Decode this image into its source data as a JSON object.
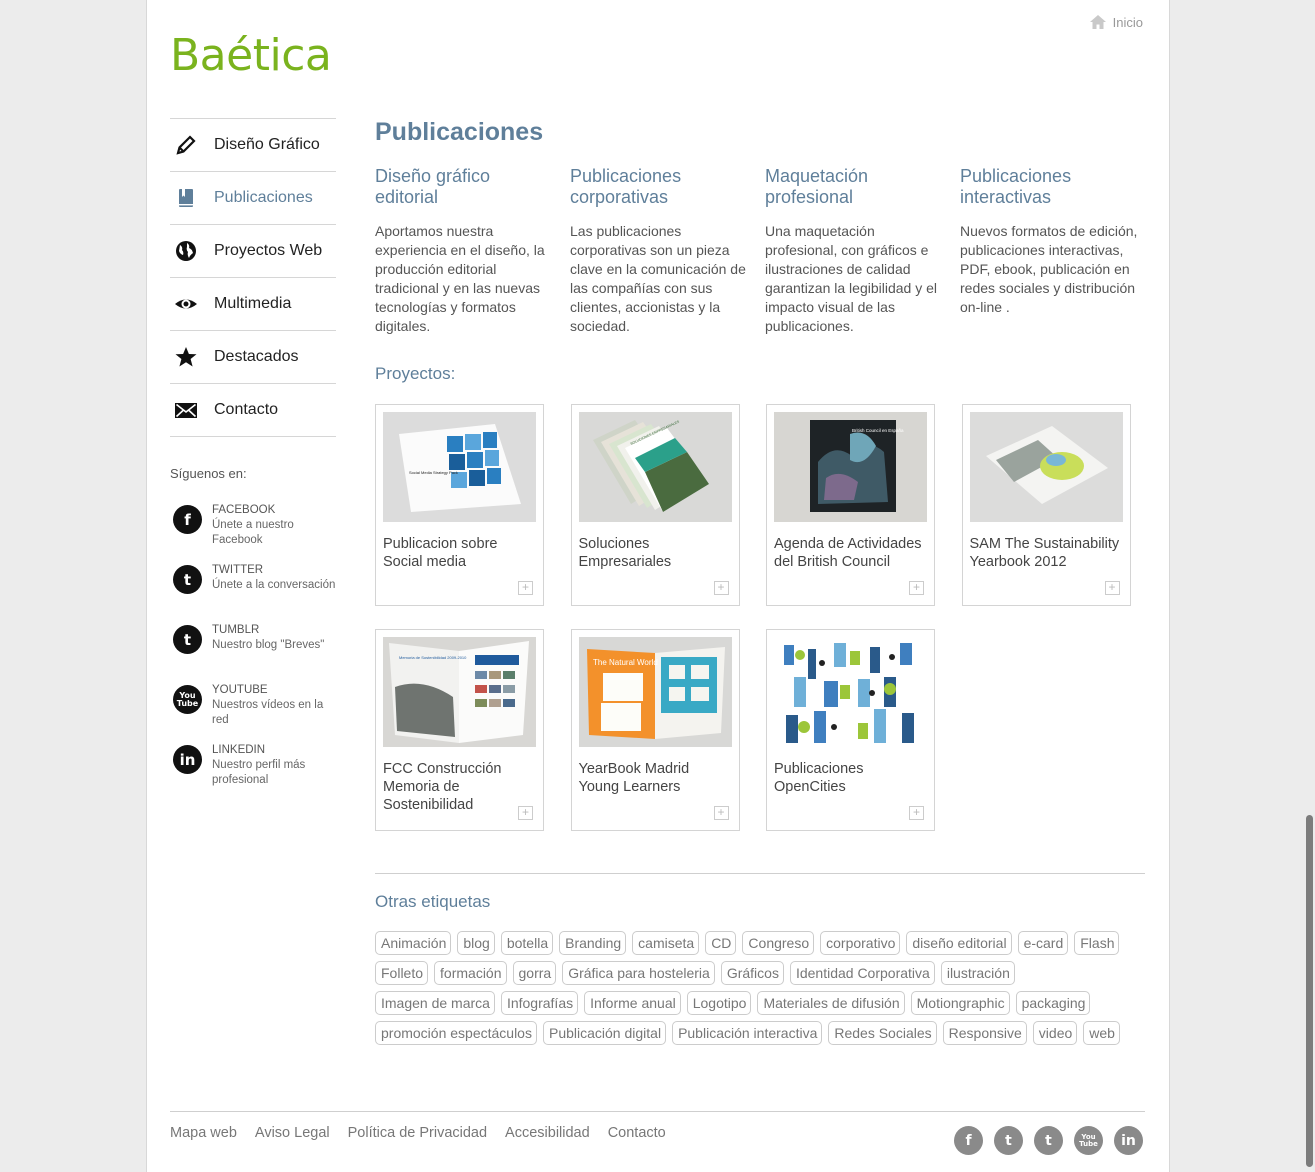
{
  "header": {
    "logo": "Baética",
    "home_label": "Inicio"
  },
  "nav": {
    "items": [
      {
        "label": "Diseño Gráfico",
        "icon": "pencil-icon"
      },
      {
        "label": "Publicaciones",
        "icon": "book-icon"
      },
      {
        "label": "Proyectos Web",
        "icon": "globe-icon"
      },
      {
        "label": "Multimedia",
        "icon": "eye-icon"
      },
      {
        "label": "Destacados",
        "icon": "star-icon"
      },
      {
        "label": "Contacto",
        "icon": "envelope-icon"
      }
    ],
    "active_index": 1
  },
  "social": {
    "title": "Síguenos en:",
    "items": [
      {
        "name": "FACEBOOK",
        "desc": "Únete a nuestro Facebook",
        "icon": "facebook-icon"
      },
      {
        "name": "TWITTER",
        "desc": "Únete a la conversación",
        "icon": "twitter-icon"
      },
      {
        "name": "TUMBLR",
        "desc": "Nuestro blog \"Breves\"",
        "icon": "tumblr-icon"
      },
      {
        "name": "YOUTUBE",
        "desc": "Nuestros vídeos en la red",
        "icon": "youtube-icon"
      },
      {
        "name": "LINKEDIN",
        "desc": "Nuestro perfil más profesional",
        "icon": "linkedin-icon"
      }
    ]
  },
  "main": {
    "title": "Publicaciones",
    "services": [
      {
        "title": "Diseño gráfico editorial",
        "desc": "Aportamos nuestra experiencia en el diseño, la producción editorial tradicional y en las nuevas tecnologías y formatos digitales."
      },
      {
        "title": "Publicaciones corporativas",
        "desc": "Las publicaciones corporativas son un pieza clave en la comunicación de las compañías con sus clientes, accionistas y la sociedad."
      },
      {
        "title": "Maquetación profesional",
        "desc": "Una maquetación profesional, con gráficos e ilustraciones de calidad garantizan la legibilidad y el impacto visual de las publicaciones."
      },
      {
        "title": "Publicaciones interactivas",
        "desc": "Nuevos formatos de edición, publicaciones interactivas, PDF, ebook, publicación en redes sociales y distribución on-line ."
      }
    ],
    "projects_title": "Proyectos:",
    "projects": [
      {
        "name": "Publicacion sobre Social media",
        "thumb_text": "Social Media Strategy Pack"
      },
      {
        "name": "Soluciones Empresariales",
        "thumb_text": "SOLUCIONES EMPRESARIALES"
      },
      {
        "name": "Agenda de Actividades del British Council",
        "thumb_text": "British Council en España"
      },
      {
        "name": "SAM The Sustainability Yearbook 2012",
        "thumb_text": ""
      },
      {
        "name": "FCC Construcción Memoria de Sostenibilidad",
        "thumb_text": "Memoria de Sostenibilidad 2009-2010"
      },
      {
        "name": "YearBook Madrid Young Learners",
        "thumb_text": "The Natural World"
      },
      {
        "name": "Publicaciones OpenCities",
        "thumb_text": ""
      }
    ],
    "tags_title": "Otras etiquetas",
    "tags": [
      "Animación",
      "blog",
      "botella",
      "Branding",
      "camiseta",
      "CD",
      "Congreso",
      "corporativo",
      "diseño editorial",
      "e-card",
      "Flash",
      "Folleto",
      "formación",
      "gorra",
      "Gráfica para hosteleria",
      "Gráficos",
      "Identidad Corporativa",
      "ilustración",
      "Imagen de marca",
      "Infografías",
      "Informe anual",
      "Logotipo",
      "Materiales de difusión",
      "Motiongraphic",
      "packaging",
      "promoción espectáculos",
      "Publicación digital",
      "Publicación interactiva",
      "Redes Sociales",
      "Responsive",
      "video",
      "web"
    ]
  },
  "footer": {
    "links": [
      "Mapa web",
      "Aviso Legal",
      "Política de Privacidad",
      "Accesibilidad",
      "Contacto"
    ],
    "social_icons": [
      "facebook-icon",
      "twitter-icon",
      "tumblr-icon",
      "youtube-icon",
      "linkedin-icon"
    ]
  },
  "colors": {
    "brand_green": "#7ab31e",
    "heading_blue": "#5f7f9a"
  }
}
